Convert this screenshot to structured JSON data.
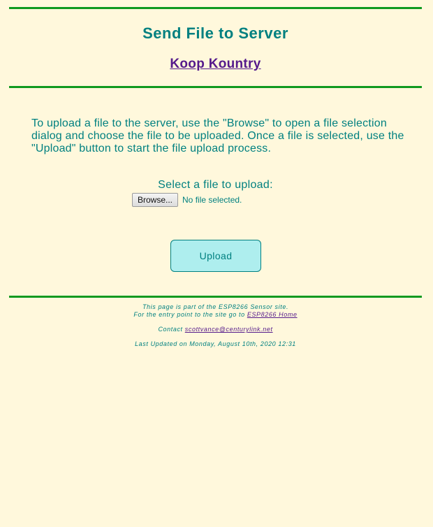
{
  "header": {
    "title": "Send File to Server",
    "site_link": "Koop Kountry"
  },
  "main": {
    "instructions": "To upload a file to the server, use the \"Browse\" to open a file selection dialog and choose the file to be uploaded. Once a file is selected, use the \"Upload\" button to start the file upload process.",
    "select_label": "Select a file to upload:",
    "browse_label": "Browse...",
    "file_status": "No file selected.",
    "upload_label": "Upload"
  },
  "footer": {
    "line1": "This page is part of the ESP8266 Sensor site.",
    "line2_prefix": "For the entry point to the site go to",
    "home_link": "ESP8266 Home",
    "contact_prefix": "Contact",
    "contact_email": "scottvance@centurylink.net",
    "last_updated": "Last Updated on Monday, August 10th, 2020 12:31"
  },
  "colors": {
    "background": "#fff8dc",
    "text": "#008080",
    "rule": "#0f9a1f",
    "link": "#551a8b",
    "upload_button": "#aeeeee"
  }
}
